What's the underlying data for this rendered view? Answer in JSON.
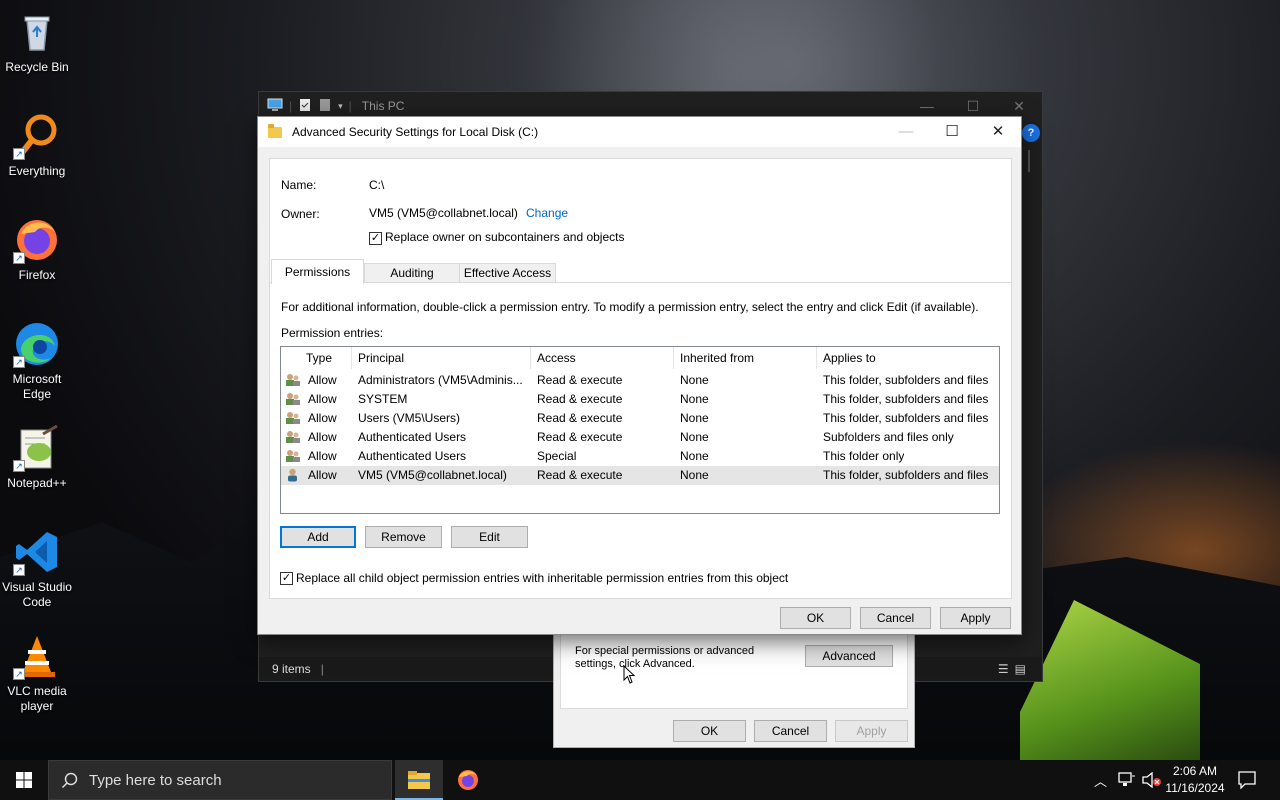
{
  "desktop": {
    "icons": [
      {
        "label": "Recycle Bin",
        "icon": "recycle-bin-icon"
      },
      {
        "label": "Everything",
        "icon": "everything-search-icon"
      },
      {
        "label": "Firefox",
        "icon": "firefox-icon"
      },
      {
        "label": "Microsoft Edge",
        "icon": "edge-icon"
      },
      {
        "label": "Notepad++",
        "icon": "notepadpp-icon"
      },
      {
        "label": "Visual Studio Code",
        "icon": "vscode-icon"
      },
      {
        "label": "VLC media player",
        "icon": "vlc-icon"
      }
    ]
  },
  "explorer": {
    "title": "This PC",
    "status_items": "9 items",
    "help_glyph": "?"
  },
  "properties_dialog": {
    "note": "For special permissions or advanced settings, click Advanced.",
    "advanced_label": "Advanced",
    "ok_label": "OK",
    "cancel_label": "Cancel",
    "apply_label": "Apply"
  },
  "dialog": {
    "title": "Advanced Security Settings for Local Disk (C:)",
    "name_label": "Name:",
    "name_value": "C:\\",
    "owner_label": "Owner:",
    "owner_value": "VM5 (VM5@collabnet.local)",
    "change_link": "Change",
    "replace_owner_label": "Replace owner on subcontainers and objects",
    "replace_owner_checked": true,
    "tabs": [
      "Permissions",
      "Auditing",
      "Effective Access"
    ],
    "active_tab": "Permissions",
    "info_text": "For additional information, double-click a permission entry. To modify a permission entry, select the entry and click Edit (if available).",
    "entries_label": "Permission entries:",
    "columns": [
      "Type",
      "Principal",
      "Access",
      "Inherited from",
      "Applies to"
    ],
    "rows": [
      {
        "type": "Allow",
        "principal": "Administrators (VM5\\Adminis...",
        "access": "Read & execute",
        "inherited": "None",
        "applies": "This folder, subfolders and files",
        "icon": "group-users-icon"
      },
      {
        "type": "Allow",
        "principal": "SYSTEM",
        "access": "Read & execute",
        "inherited": "None",
        "applies": "This folder, subfolders and files",
        "icon": "group-users-icon"
      },
      {
        "type": "Allow",
        "principal": "Users (VM5\\Users)",
        "access": "Read & execute",
        "inherited": "None",
        "applies": "This folder, subfolders and files",
        "icon": "group-users-icon"
      },
      {
        "type": "Allow",
        "principal": "Authenticated Users",
        "access": "Read & execute",
        "inherited": "None",
        "applies": "Subfolders and files only",
        "icon": "group-users-icon"
      },
      {
        "type": "Allow",
        "principal": "Authenticated Users",
        "access": "Special",
        "inherited": "None",
        "applies": "This folder only",
        "icon": "group-users-icon"
      },
      {
        "type": "Allow",
        "principal": "VM5 (VM5@collabnet.local)",
        "access": "Read & execute",
        "inherited": "None",
        "applies": "This folder, subfolders and files",
        "icon": "single-user-icon"
      }
    ],
    "selected_row": 5,
    "add_label": "Add",
    "remove_label": "Remove",
    "edit_label": "Edit",
    "replace_child_label": "Replace all child object permission entries with inheritable permission entries from this object",
    "replace_child_checked": true,
    "ok_label": "OK",
    "cancel_label": "Cancel",
    "apply_label": "Apply"
  },
  "taskbar": {
    "search_placeholder": "Type here to search",
    "time": "2:06 AM",
    "date": "11/16/2024"
  },
  "colors": {
    "accent": "#0078d7",
    "link": "#0066cc",
    "dialog_bg": "#f0f0f0",
    "taskbar_bg": "#101010"
  }
}
